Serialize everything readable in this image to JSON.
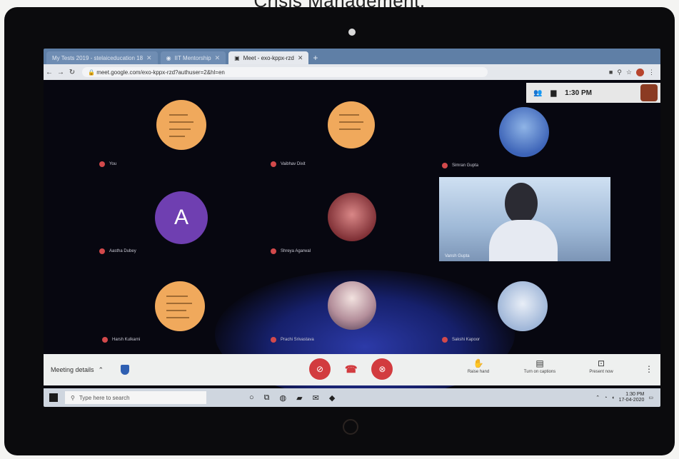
{
  "caption": "Crisis Management.",
  "browser": {
    "tabs": [
      {
        "label": "My Tests 2019 - stelaiceducation 18",
        "icon": "globe-icon"
      },
      {
        "label": "IIT Mentorship",
        "icon": "globe-icon"
      },
      {
        "label": "Meet - exo-kppx-rzd",
        "icon": "camera-icon"
      }
    ],
    "url": "meet.google.com/exo-kppx-rzd?authuser=2&hl=en"
  },
  "status": {
    "time": "1:30 PM"
  },
  "participants": [
    {
      "name": "You",
      "avatar": "orange-doc"
    },
    {
      "name": "Vaibhav Dixit",
      "avatar": "orange-doc"
    },
    {
      "name": "Simran Gupta",
      "avatar": "photo-blue"
    },
    {
      "name": "Aastha Dubey",
      "avatar": "letter",
      "letter": "A"
    },
    {
      "name": "Shreya Agarwal",
      "avatar": "photo-red"
    },
    {
      "name": "Vansh Gupta",
      "avatar": "video"
    },
    {
      "name": "Harsh Kulkarni",
      "avatar": "orange-doc"
    },
    {
      "name": "Prachi Srivastava",
      "avatar": "photo-girl"
    },
    {
      "name": "Sakshi Kapoor",
      "avatar": "photo-pale"
    }
  ],
  "meet_bar": {
    "details_label": "Meeting details",
    "controls": [
      {
        "label": "Raise hand",
        "icon": "hand-icon"
      },
      {
        "label": "Turn on captions",
        "icon": "captions-icon"
      },
      {
        "label": "Present now",
        "icon": "present-icon"
      }
    ]
  },
  "taskbar": {
    "search_placeholder": "Type here to search",
    "time": "1:30 PM",
    "date": "17-04-2020"
  }
}
